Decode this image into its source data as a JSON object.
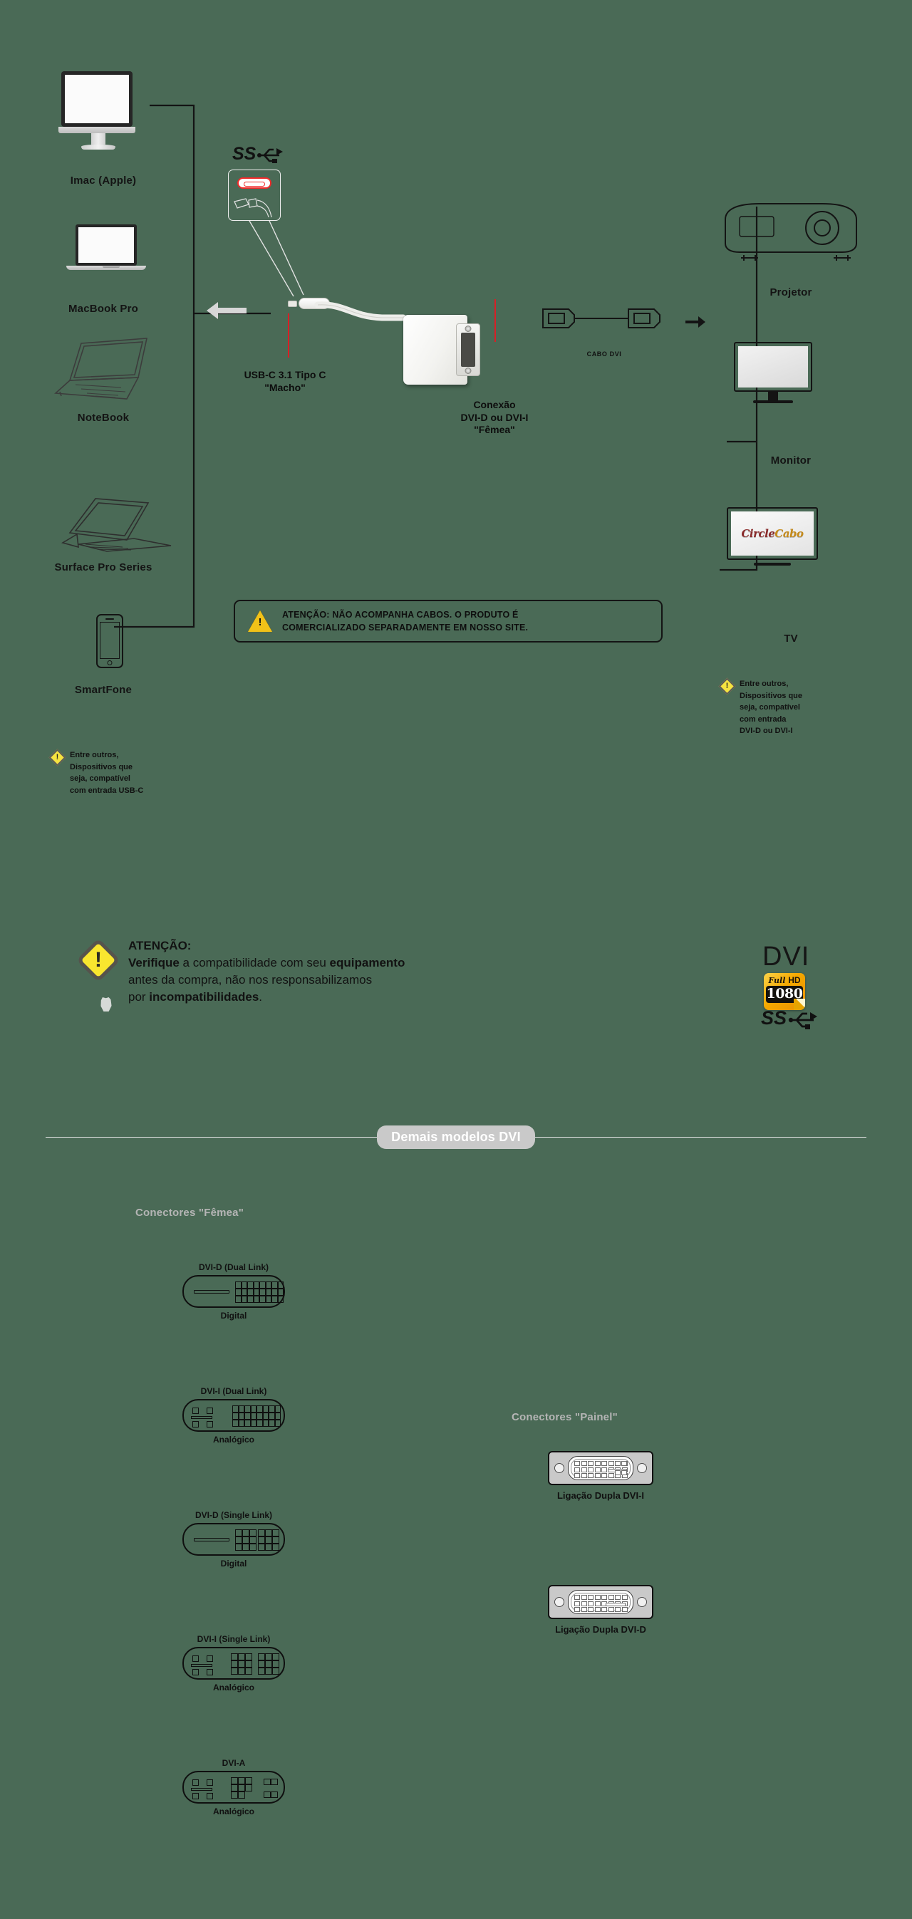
{
  "colors": {
    "background": "#4a6a56",
    "accent_red": "#d81f26",
    "warning_yellow": "#f5e340",
    "badge_orange": "#f5a800",
    "pill_gray": "#c9c9c9",
    "subhead_gray": "#b5b5b5"
  },
  "sources": {
    "items": [
      {
        "label": "Imac (Apple)",
        "icon": "imac-icon"
      },
      {
        "label": "MacBook Pro",
        "icon": "macbook-icon"
      },
      {
        "label": "NoteBook",
        "icon": "notebook-icon"
      },
      {
        "label": "Surface Pro Series",
        "icon": "surface-tablet-icon"
      },
      {
        "label": "SmartFone",
        "icon": "smartphone-icon"
      }
    ],
    "note": {
      "icon": "warning-diamond-icon",
      "mark": "!",
      "text": "Entre outros,\nDispositivos que\nseja, compatível\ncom entrada  USB-C"
    }
  },
  "usbc_callout": {
    "port_icon": "usb-c-port-icon",
    "ss_logo": "superspeed-usb-icon",
    "title": "USB-C 3.1 Tipo C",
    "subtitle": "\"Macho\""
  },
  "adapter_callout": {
    "line1": "Conexão",
    "line2": "DVI-D ou DVI-I",
    "line3": "\"Fêmea\""
  },
  "dvi_cable": {
    "label": "CABO DVI",
    "icon": "dvi-cable-icon"
  },
  "outputs": {
    "items": [
      {
        "label": "Projetor",
        "icon": "projector-icon"
      },
      {
        "label": "Monitor",
        "icon": "monitor-icon"
      },
      {
        "label": "TV",
        "icon": "tv-icon"
      }
    ],
    "tv_logo_left": "Circle",
    "tv_logo_right": "Cabo",
    "note": {
      "icon": "warning-diamond-icon",
      "mark": "!",
      "text": "Entre outros,\nDispositivos que\nseja, compatível\ncom entrada\nDVI-D ou DVI-I"
    }
  },
  "cable_warning": {
    "icon": "warning-triangle-icon",
    "mark": "!",
    "line1_strong": "ATENÇÃO",
    "line1_rest": ": NÃO ACOMPANHA CABOS. O PRODUTO É",
    "line2": "COMERCIALIZADO SEPARADAMENTE EM NOSSO SITE."
  },
  "main_warning": {
    "icon": "warning-diamond-large-icon",
    "mark": "!",
    "heading": "ATENÇÃO:",
    "l2_b1": "Verifique",
    "l2_t1": " a compatibilidade com seu ",
    "l2_b2": "equipamento",
    "line3": "antes da compra, não nos responsabilizamos",
    "l4_t1": "por ",
    "l4_b1": "incompatibilidades",
    "l4_t2": "."
  },
  "badges": {
    "fullhd_top": "Full HD",
    "fullhd_full": "Full",
    "fullhd_hd": "HD",
    "fullhd_number": "1080",
    "dvi": "DVI",
    "ss_logo": "superspeed-usb-icon",
    "ss_text": "SS"
  },
  "section": {
    "title": "Demais modelos DVI",
    "female_heading": "Conectores \"Fêmea\"",
    "panel_heading": "Conectores \"Painel\""
  },
  "female_connectors": [
    {
      "title": "DVI-D (Dual Link)",
      "sub": "Digital",
      "type": "d-dual"
    },
    {
      "title": "DVI-I (Dual Link)",
      "sub": "Analógico",
      "type": "i-dual"
    },
    {
      "title": "DVI-D (Single Link)",
      "sub": "Digital",
      "type": "d-single"
    },
    {
      "title": "DVI-I (Single Link)",
      "sub": "Analógico",
      "type": "i-single"
    },
    {
      "title": "DVI-A",
      "sub": "Analógico",
      "type": "a"
    }
  ],
  "panel_connectors": [
    {
      "label": "Ligação Dupla DVI-I",
      "type": "i"
    },
    {
      "label": "Ligação Dupla DVI-D",
      "type": "d"
    }
  ]
}
